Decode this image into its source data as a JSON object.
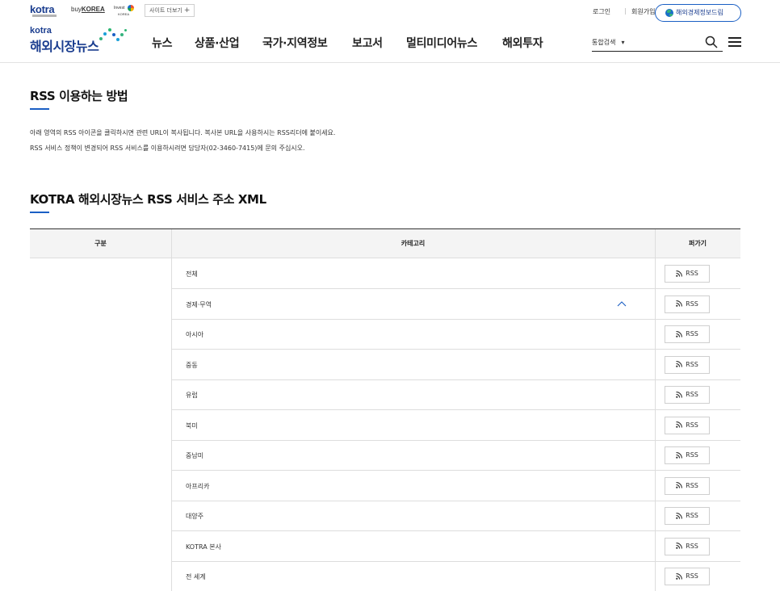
{
  "topbar": {
    "logo_kotra": "kotra",
    "logo_buykorea_prefix": "buy",
    "logo_buykorea": "KOREA",
    "logo_investkorea_top": "Invest",
    "logo_investkorea_bottom": "KOREA",
    "site_more": "사이트 더보기",
    "site_more_icon": "plus-icon",
    "login": "로그인",
    "join": "회원가입",
    "report_button": "해외경제정보드림"
  },
  "header": {
    "brand_small": "kotra",
    "brand_title": "해외시장뉴스",
    "nav": [
      "뉴스",
      "상품·산업",
      "국가·지역정보",
      "보고서",
      "멀티미디어뉴스",
      "해외투자"
    ],
    "search_scope": "통합검색",
    "search_scope_icon": "caret-down-icon",
    "search_icon": "search-icon",
    "menu_icon": "hamburger-menu-icon",
    "accent_color": "#1a5fc4"
  },
  "content": {
    "section1_title": "RSS 이용하는 방법",
    "intro_line1": "아래 영역의 RSS 아이콘을 클릭하시면 관련 URL이 복사됩니다. 복사본 URL을 사용하시는 RSS리더에 붙이세요.",
    "intro_line2": "RSS 서비스 정책이 변경되어 RSS 서비스를 이용하시려면 담당자(02-3460-7415)에 문의 주십시오.",
    "section2_title": "KOTRA 해외시장뉴스 RSS 서비스 주소 XML"
  },
  "table": {
    "headers": [
      "구분",
      "카테고리",
      "퍼가기"
    ],
    "rows": [
      {
        "category": "전체",
        "rss": "RSS"
      },
      {
        "category": "경제·무역",
        "rss": "RSS",
        "expanded": true
      },
      {
        "category": "아시아",
        "rss": "RSS"
      },
      {
        "category": "중동",
        "rss": "RSS"
      },
      {
        "category": "유럽",
        "rss": "RSS"
      },
      {
        "category": "북미",
        "rss": "RSS"
      },
      {
        "category": "중남미",
        "rss": "RSS"
      },
      {
        "category": "아프리카",
        "rss": "RSS"
      },
      {
        "category": "대양주",
        "rss": "RSS"
      },
      {
        "category": "KOTRA 본사",
        "rss": "RSS"
      },
      {
        "category": "전 세계",
        "rss": "RSS"
      }
    ],
    "rss_icon": "rss-feed-icon",
    "expand_icon": "chevron-up-icon"
  }
}
